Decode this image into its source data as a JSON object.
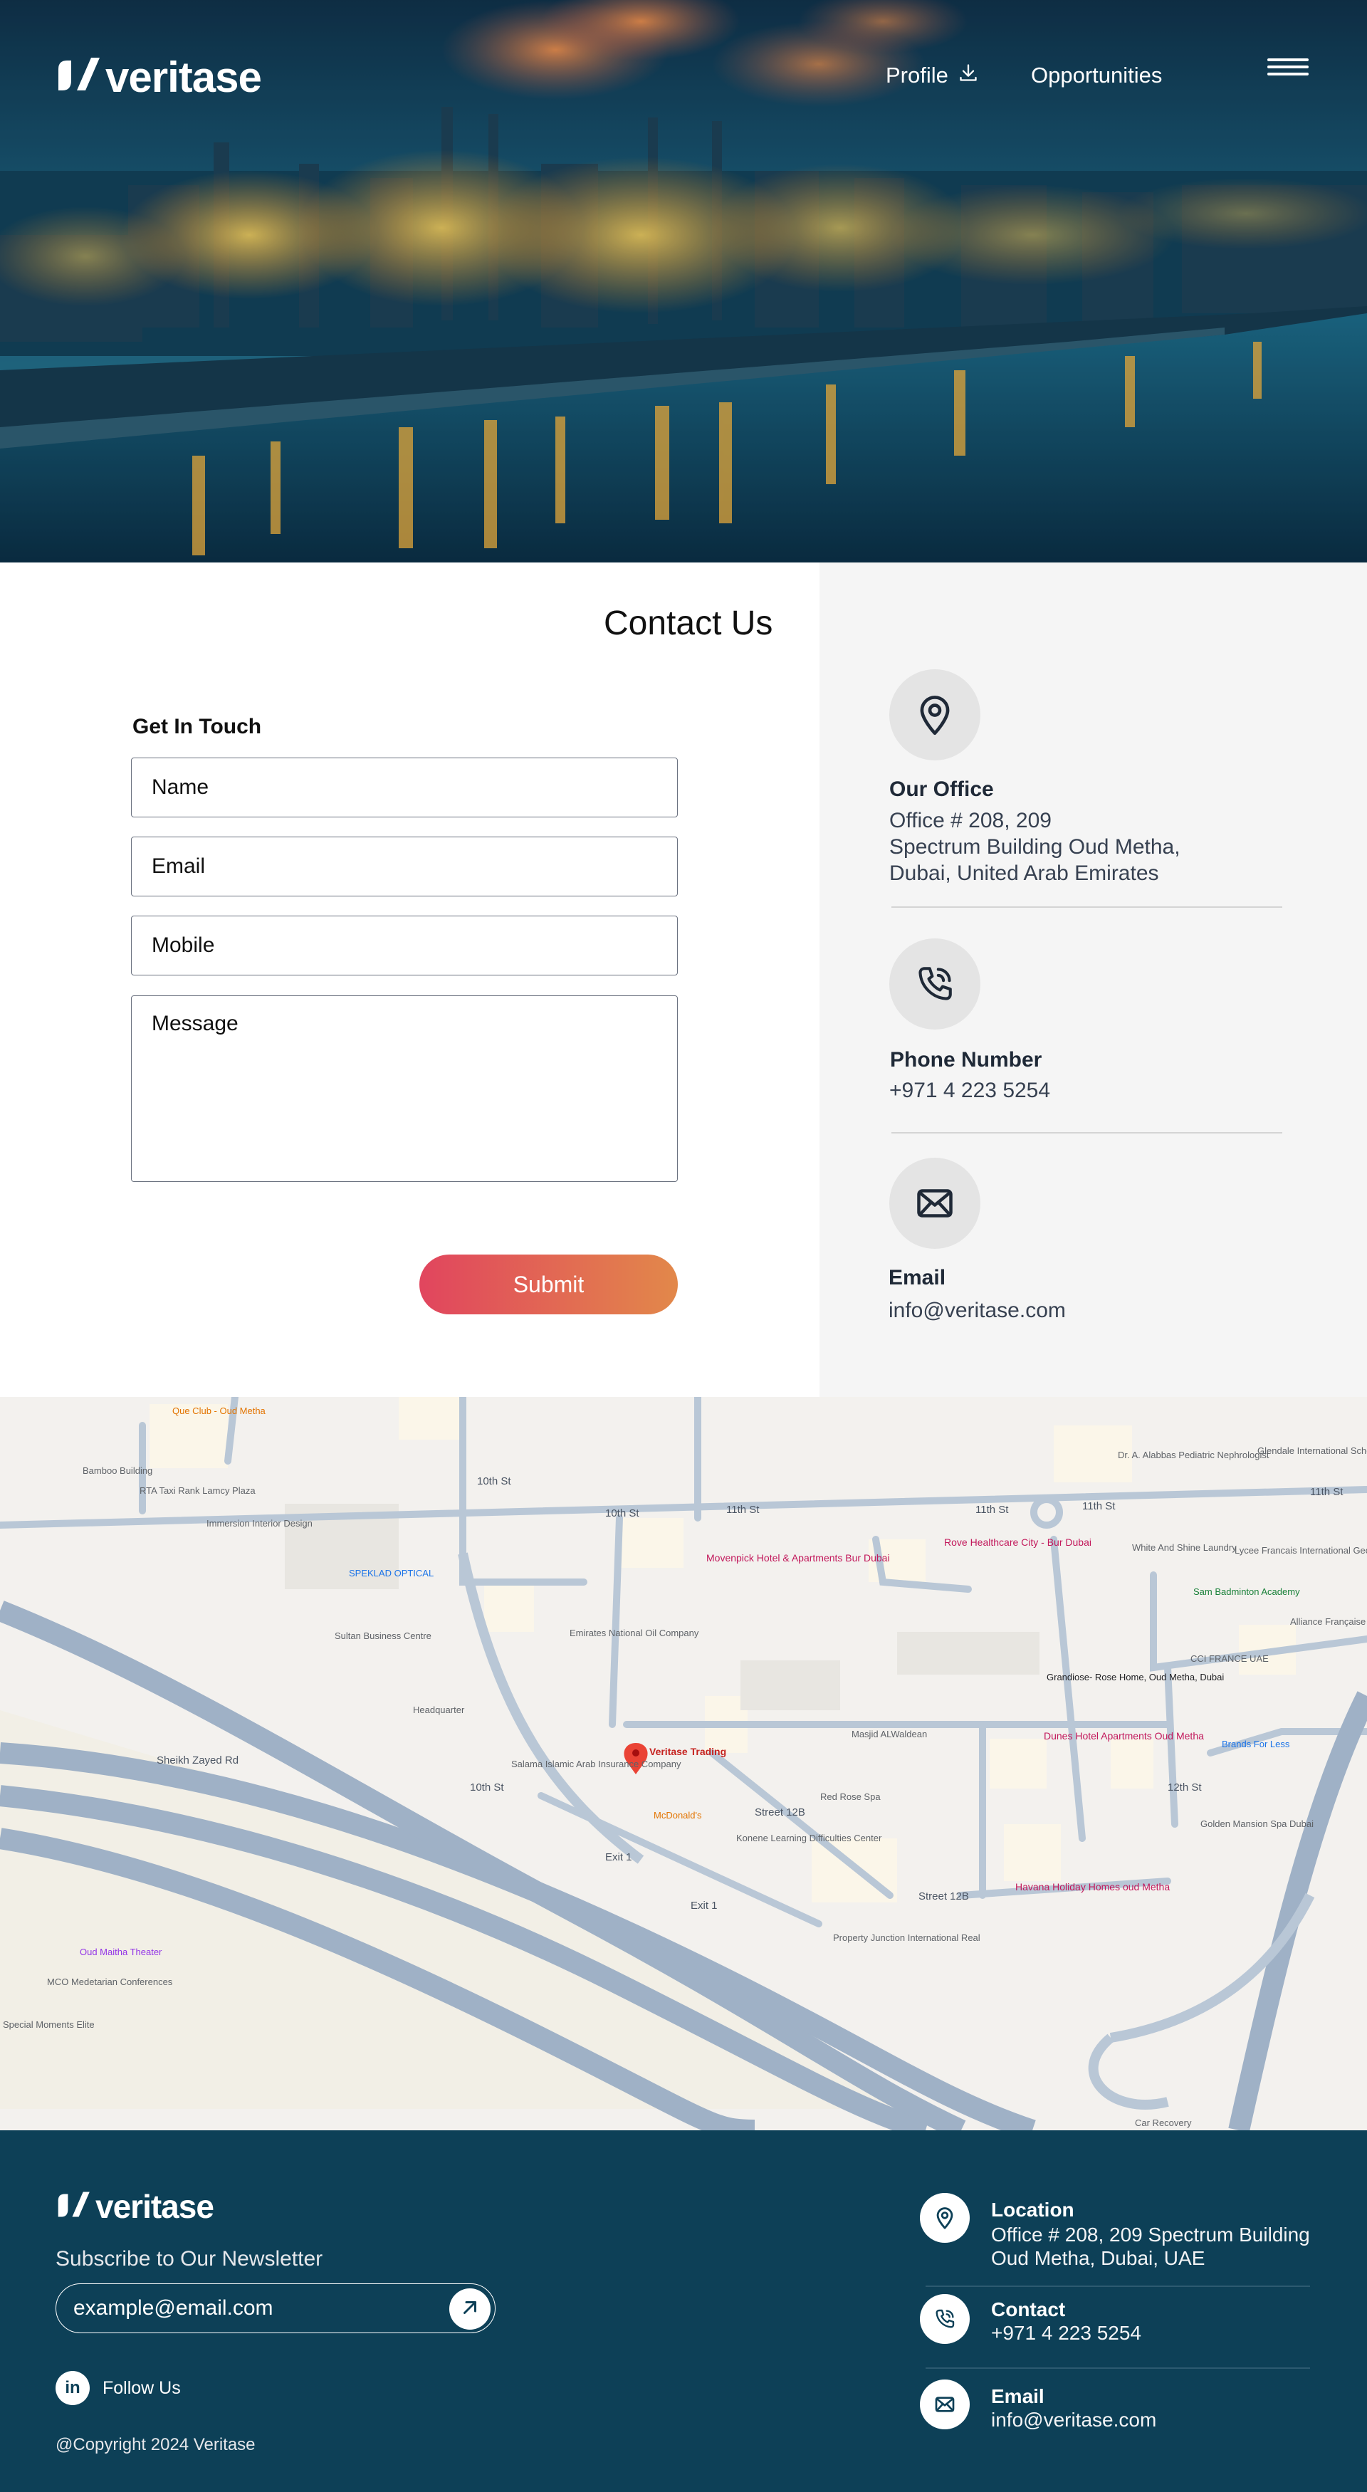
{
  "brand": {
    "name": "veritase",
    "accent": "#e1455e",
    "accent2": "#e2884a",
    "footer_bg": "#0d4057"
  },
  "nav": {
    "profile_label": "Profile",
    "profile_icon": "download-icon",
    "opportunities_label": "Opportunities",
    "menu_icon": "hamburger-icon"
  },
  "contact": {
    "title": "Contact Us",
    "form_heading": "Get In Touch",
    "name_placeholder": "Name",
    "email_placeholder": "Email",
    "mobile_placeholder": "Mobile",
    "message_placeholder": "Message",
    "submit_label": "Submit"
  },
  "info": {
    "office": {
      "icon": "location-pin-icon",
      "title": "Our Office",
      "line1": "Office # 208, 209",
      "line2": "Spectrum Building Oud Metha,",
      "line3": "Dubai, United Arab Emirates"
    },
    "phone": {
      "icon": "phone-icon",
      "title": "Phone Number",
      "value": "+971 4 223 5254"
    },
    "email": {
      "icon": "envelope-icon",
      "title": "Email",
      "value": "info@veritase.com"
    }
  },
  "map": {
    "pin_label": "Veritase Trading",
    "roads": [
      "10th St",
      "11th St",
      "10th St",
      "11th St",
      "11th St",
      "11th St",
      "Sheikh Zayed Rd",
      "Exit 1",
      "Exit 1",
      "Street 12B",
      "Street 12B",
      "12th St",
      "10th St"
    ],
    "places": [
      {
        "name": "Que Club - Oud Metha"
      },
      {
        "name": "Bamboo Building"
      },
      {
        "name": "RTA Taxi Rank Lamcy Plaza"
      },
      {
        "name": "Immersion Interior Design"
      },
      {
        "name": "SPEKLAD OPTICAL"
      },
      {
        "name": "Sultan Business Centre"
      },
      {
        "name": "Emirates National Oil Company"
      },
      {
        "name": "Headquarter"
      },
      {
        "name": "Salama Islamic Arab Insurance Company"
      },
      {
        "name": "McDonald's"
      },
      {
        "name": "Konene Learning Difficulties Center"
      },
      {
        "name": "Red Rose Spa"
      },
      {
        "name": "Masjid ALWaldean"
      },
      {
        "name": "Movenpick Hotel & Apartments Bur Dubai"
      },
      {
        "name": "Rove Healthcare City - Bur Dubai"
      },
      {
        "name": "Dr. A. Alabbas Pediatric Nephrologist"
      },
      {
        "name": "Glendale International School"
      },
      {
        "name": "White And Shine Laundry"
      },
      {
        "name": "Lycee Francais International Georges"
      },
      {
        "name": "Sam Badminton Academy"
      },
      {
        "name": "Alliance Française"
      },
      {
        "name": "CCI FRANCE UAE"
      },
      {
        "name": "Grandiose- Rose Home, Oud Metha, Dubai"
      },
      {
        "name": "Dunes Hotel Apartments Oud Metha"
      },
      {
        "name": "Brands For Less"
      },
      {
        "name": "Golden Mansion Spa Dubai"
      },
      {
        "name": "Havana Holiday Homes oud Metha"
      },
      {
        "name": "Property Junction International Real"
      },
      {
        "name": "Oud Maitha Theater"
      },
      {
        "name": "MCO Medetarian Conferences"
      },
      {
        "name": "Special Moments Elite"
      },
      {
        "name": "Car Recovery"
      }
    ]
  },
  "footer": {
    "subscribe_label": "Subscribe to Our Newsletter",
    "newsletter_placeholder": "example@email.com",
    "submit_icon": "arrow-up-right-icon",
    "follow_label": "Follow Us",
    "linkedin_icon": "linkedin-icon",
    "copyright": "@Copyright 2024 Veritase",
    "location": {
      "title": "Location",
      "line1": "Office # 208, 209 Spectrum Building",
      "line2": "Oud Metha, Dubai, UAE"
    },
    "contact": {
      "title": "Contact",
      "value": "+971 4 223 5254"
    },
    "email": {
      "title": "Email",
      "value": "info@veritase.com"
    }
  }
}
